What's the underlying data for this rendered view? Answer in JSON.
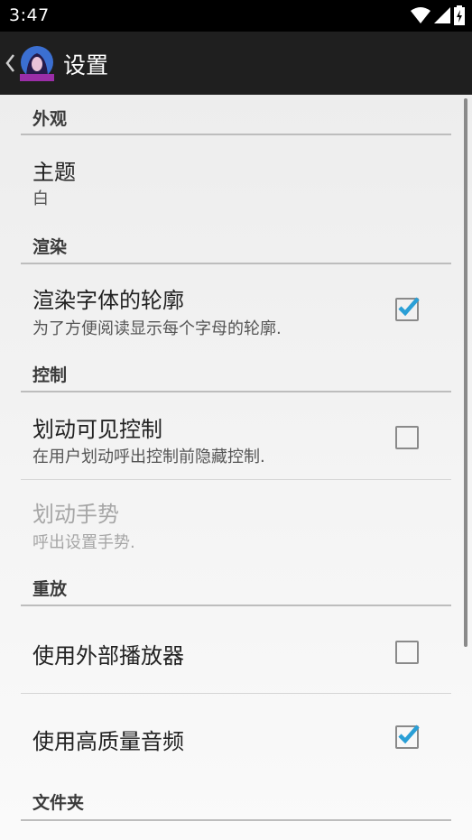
{
  "status_bar": {
    "time": "3:47"
  },
  "action_bar": {
    "title": "设置"
  },
  "categories": {
    "appearance": "外观",
    "rendering": "渲染",
    "controls": "控制",
    "playback": "重放",
    "folders": "文件夹"
  },
  "prefs": {
    "theme": {
      "title": "主题",
      "summary": "白"
    },
    "font_outline": {
      "title": "渲染字体的轮廓",
      "summary": "为了方便阅读显示每个字母的轮廓.",
      "checked": true
    },
    "swipe_controls": {
      "title": "划动可见控制",
      "summary": "在用户划动呼出控制前隐藏控制.",
      "checked": false
    },
    "swipe_gesture": {
      "title": "划动手势",
      "summary": "呼出设置手势.",
      "enabled": false
    },
    "external_player": {
      "title": "使用外部播放器",
      "checked": false
    },
    "hq_audio": {
      "title": "使用高质量音频",
      "checked": true
    }
  },
  "colors": {
    "accent": "#2a9fd6",
    "action_bar": "#1f1f1f",
    "status_bar": "#000000"
  }
}
